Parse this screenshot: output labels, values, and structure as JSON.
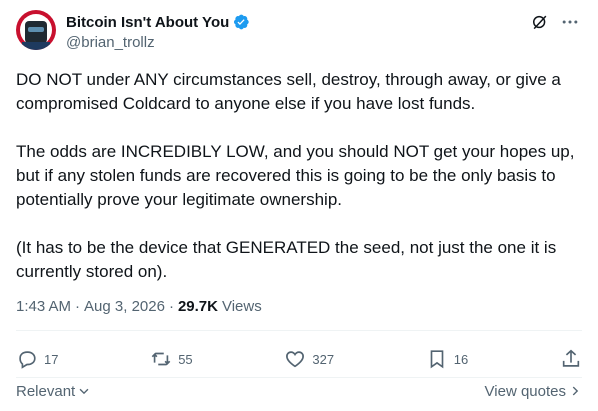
{
  "author": {
    "display_name": "Bitcoin Isn't About You",
    "handle": "@brian_trollz",
    "verified_icon": "verified-badge-icon",
    "avatar_colors": {
      "primary": "#c8102e",
      "secondary": "#1e3a5f"
    }
  },
  "post": {
    "paragraphs": [
      "DO NOT under ANY circumstances sell, destroy, through away, or give a compromised Coldcard to anyone else if you have lost funds.",
      "The odds are INCREDIBLY LOW, and you should NOT get your hopes up, but if any stolen funds are recovered this is going to be the only basis to potentially prove your legitimate ownership.",
      "(It has to be the device that GENERATED the seed, not just the one it is currently stored on)."
    ],
    "time": "1:43 AM",
    "separator": "·",
    "date": "Aug 3, 2026",
    "views_count": "29.7K",
    "views_label": "Views"
  },
  "actions": {
    "replies": "17",
    "reposts": "55",
    "likes": "327",
    "bookmarks": "16"
  },
  "footer": {
    "sort_label": "Relevant",
    "view_quotes_label": "View quotes"
  },
  "colors": {
    "text": "#0f1419",
    "secondary": "#536471",
    "accent": "#1d9bf0",
    "divider": "#eff3f4"
  }
}
